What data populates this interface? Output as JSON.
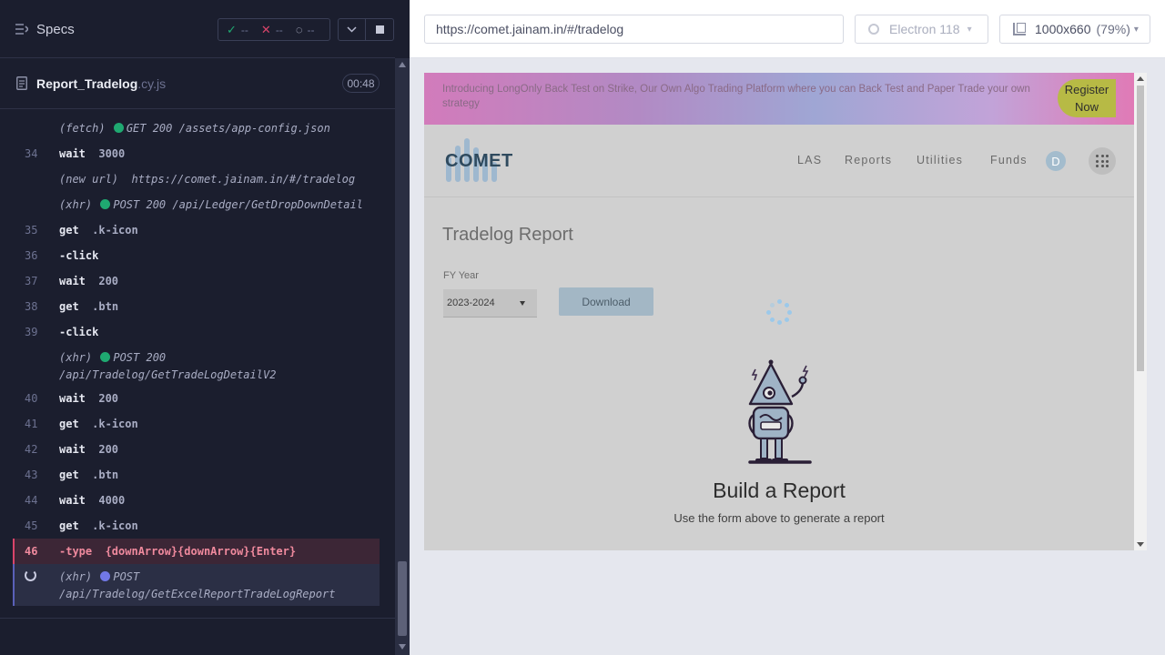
{
  "runner": {
    "specs_label": "Specs",
    "stats": {
      "passed": "--",
      "failed": "--",
      "pending": "--"
    },
    "spec_file": {
      "name": "Report_Tradelog",
      "ext": ".cy.js",
      "duration": "00:48"
    },
    "commands": [
      {
        "kind": "event",
        "type": "(fetch)",
        "status": "GET 200",
        "path": "/assets/app-config.json"
      },
      {
        "kind": "cmd",
        "num": "34",
        "name": "wait",
        "arg": "3000"
      },
      {
        "kind": "event",
        "type": "(new url)",
        "path": "https://comet.jainam.in/#/tradelog"
      },
      {
        "kind": "event",
        "type": "(xhr)",
        "status": "POST 200",
        "path": "/api/Ledger/GetDropDownDetail"
      },
      {
        "kind": "cmd",
        "num": "35",
        "name": "get",
        "arg": ".k-icon"
      },
      {
        "kind": "cmd",
        "num": "36",
        "name": "-click",
        "arg": ""
      },
      {
        "kind": "cmd",
        "num": "37",
        "name": "wait",
        "arg": "200"
      },
      {
        "kind": "cmd",
        "num": "38",
        "name": "get",
        "arg": ".btn"
      },
      {
        "kind": "cmd",
        "num": "39",
        "name": "-click",
        "arg": ""
      },
      {
        "kind": "event",
        "type": "(xhr)",
        "status": "POST 200",
        "path": "/api/Tradelog/GetTradeLogDetailV2"
      },
      {
        "kind": "cmd",
        "num": "40",
        "name": "wait",
        "arg": "200"
      },
      {
        "kind": "cmd",
        "num": "41",
        "name": "get",
        "arg": ".k-icon"
      },
      {
        "kind": "cmd",
        "num": "42",
        "name": "wait",
        "arg": "200"
      },
      {
        "kind": "cmd",
        "num": "43",
        "name": "get",
        "arg": ".btn"
      },
      {
        "kind": "cmd",
        "num": "44",
        "name": "wait",
        "arg": "4000"
      },
      {
        "kind": "cmd",
        "num": "45",
        "name": "get",
        "arg": ".k-icon"
      },
      {
        "kind": "cmd",
        "num": "46",
        "name": "-type",
        "arg": "{downArrow}{downArrow}{Enter}"
      },
      {
        "kind": "event",
        "type": "(xhr)",
        "status": "POST",
        "path": "/api/Tradelog/GetExcelReportTradeLogReport"
      }
    ]
  },
  "topbar": {
    "url": "https://comet.jainam.in/#/tradelog",
    "browser": "Electron 118",
    "viewport": "1000x660",
    "zoom": "(79%)"
  },
  "app": {
    "banner_text": "Introducing LongOnly Back Test on Strike, Our Own Algo Trading Platform where you can Back Test and Paper Trade your own strategy",
    "register": "Register Now",
    "logo_text": "COMET",
    "nav": [
      "LAS",
      "Reports",
      "Utilities",
      "Funds"
    ],
    "avatar": "D",
    "page_title": "Tradelog Report",
    "fy_label": "FY Year",
    "fy_value": "2023-2024",
    "download_label": "Download",
    "empty_title": "Build a Report",
    "empty_sub": "Use the form above to generate a report"
  },
  "colors": {
    "pass": "#1fa971",
    "fail": "#d9446a",
    "pending": "#7178e6",
    "banner_button": "#b7ba45"
  }
}
